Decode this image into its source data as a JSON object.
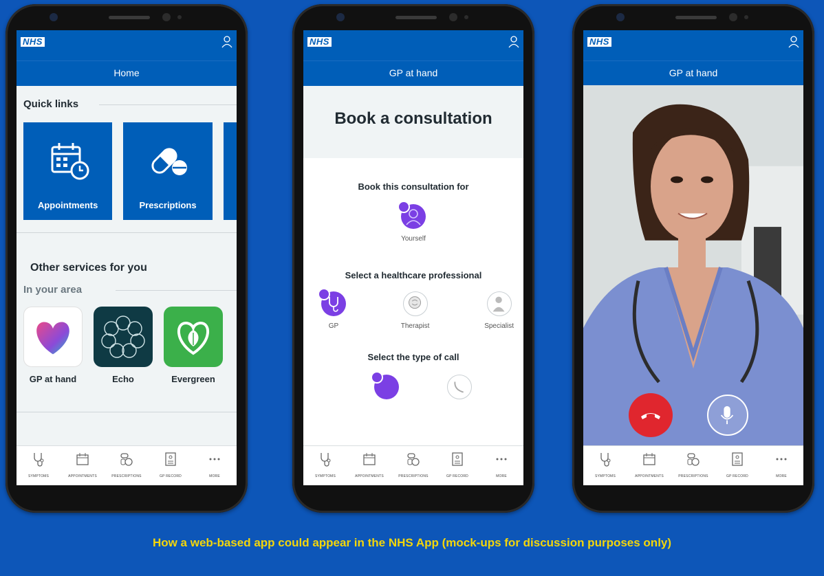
{
  "caption": "How a web-based app could appear in the NHS App (mock-ups for discussion purposes only)",
  "brand": {
    "logo": "NHS",
    "blue": "#005eb8",
    "purple": "#7b3fe4",
    "caption_yellow": "#f4d60a"
  },
  "bottom_nav": [
    "SYMPTOMS",
    "APPOINTMENTS",
    "PRESCRIPTIONS",
    "GP RECORD",
    "MORE"
  ],
  "phone1": {
    "title": "Home",
    "quick_links_heading": "Quick links",
    "quick_links": [
      "Appointments",
      "Prescriptions"
    ],
    "other_services_heading": "Other services for you",
    "in_your_area": "In your area",
    "apps": [
      "GP at hand",
      "Echo",
      "Evergreen"
    ]
  },
  "phone2": {
    "title": "GP at hand",
    "heading": "Book a consultation",
    "book_for_label": "Book this consultation for",
    "book_for_option": "Yourself",
    "professional_label": "Select a healthcare professional",
    "professionals": [
      "GP",
      "Therapist",
      "Specialist"
    ],
    "call_type_label": "Select the type of call"
  },
  "phone3": {
    "title": "GP at hand"
  }
}
